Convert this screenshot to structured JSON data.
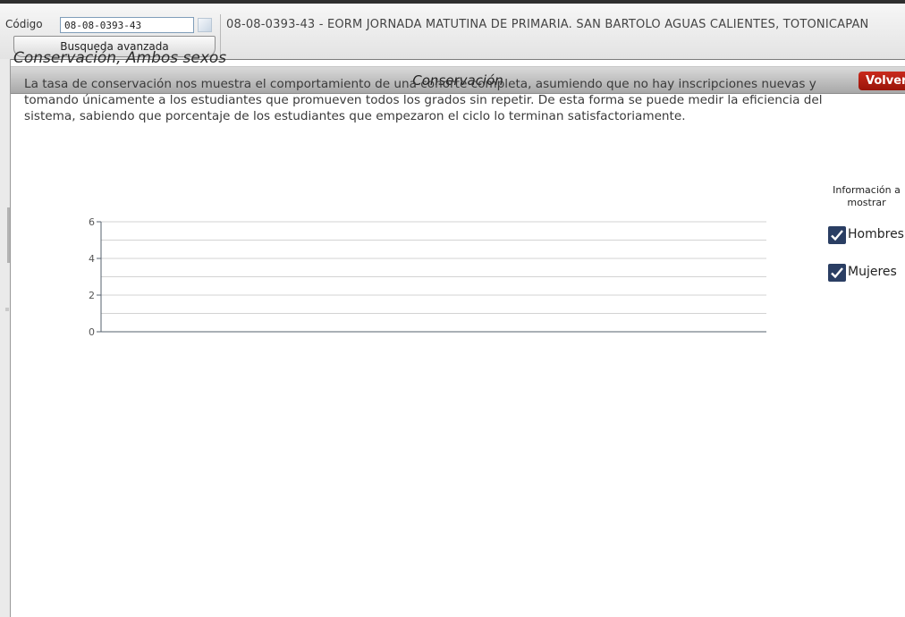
{
  "header": {
    "code_label": "Código",
    "code_value": "08-08-0393-43",
    "advanced_search_label": "Busqueda avanzada",
    "school_name": "08-08-0393-43 - EORM JORNADA MATUTINA DE PRIMARIA. SAN BARTOLO AGUAS CALIENTES, TOTONICAPAN"
  },
  "panel": {
    "title": "Conservación",
    "back_label": "Volver"
  },
  "content": {
    "section_title": "Conservación, Ambos sexos",
    "description": "La tasa de conservación nos muestra el comportamiento de una cohorte completa, asumiendo que no hay inscripciones nuevas y tomando únicamente a los estudiantes que promueven todos los grados sin repetir. De esta forma se puede medir la eficiencia del sistema, sabiendo que porcentaje de los estudiantes que empezaron el ciclo lo terminan satisfactoriamente."
  },
  "options": {
    "title": "Información a mostrar",
    "items": [
      {
        "label": "Hombres",
        "checked": true
      },
      {
        "label": "Mujeres",
        "checked": true
      }
    ]
  },
  "chart_data": {
    "type": "line",
    "title": "",
    "xlabel": "",
    "ylabel": "",
    "ylim": [
      0,
      6
    ],
    "y_ticks": [
      0,
      2,
      4,
      6
    ],
    "categories": [],
    "series": [],
    "grid": true
  },
  "colors": {
    "volver_bg": "#b81d10",
    "checkbox_bg": "#2a3e63",
    "axis": "#55606e"
  }
}
